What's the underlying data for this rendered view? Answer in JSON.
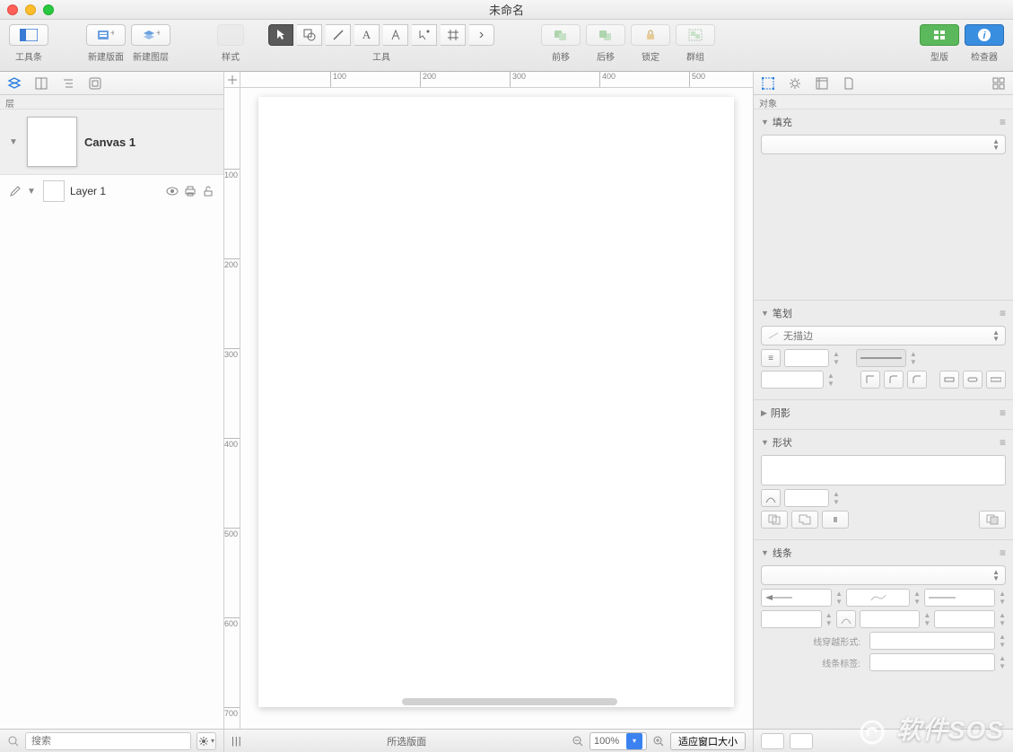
{
  "window": {
    "title": "未命名"
  },
  "toolbar": {
    "toolbar_label": "工具条",
    "new_canvas": "新建版面",
    "new_layer": "新建图层",
    "style": "样式",
    "tools_label": "工具",
    "move_forward": "前移",
    "move_back": "后移",
    "lock": "锁定",
    "group": "群组",
    "stencils": "型版",
    "inspector": "检查器"
  },
  "left_panel": {
    "tab_label": "层",
    "canvas_name": "Canvas 1",
    "layer_name": "Layer 1"
  },
  "search": {
    "placeholder": "搜索"
  },
  "canvas": {
    "ruler_ticks_h": [
      100,
      200,
      300,
      400,
      500
    ],
    "ruler_ticks_v": [
      100,
      200,
      300,
      400,
      500,
      600,
      700
    ]
  },
  "status": {
    "selection": "所选版面",
    "zoom": "100%",
    "fit": "适应窗口大小"
  },
  "inspector": {
    "tab_label": "对象",
    "fill": {
      "title": "填充"
    },
    "stroke": {
      "title": "笔划",
      "no_stroke": "无描边"
    },
    "shadow": {
      "title": "阴影"
    },
    "shape": {
      "title": "形状"
    },
    "line": {
      "title": "线条",
      "cross_shape": "线穿越形式:",
      "line_label": "线条标签:"
    }
  },
  "watermark": "软件SOS"
}
